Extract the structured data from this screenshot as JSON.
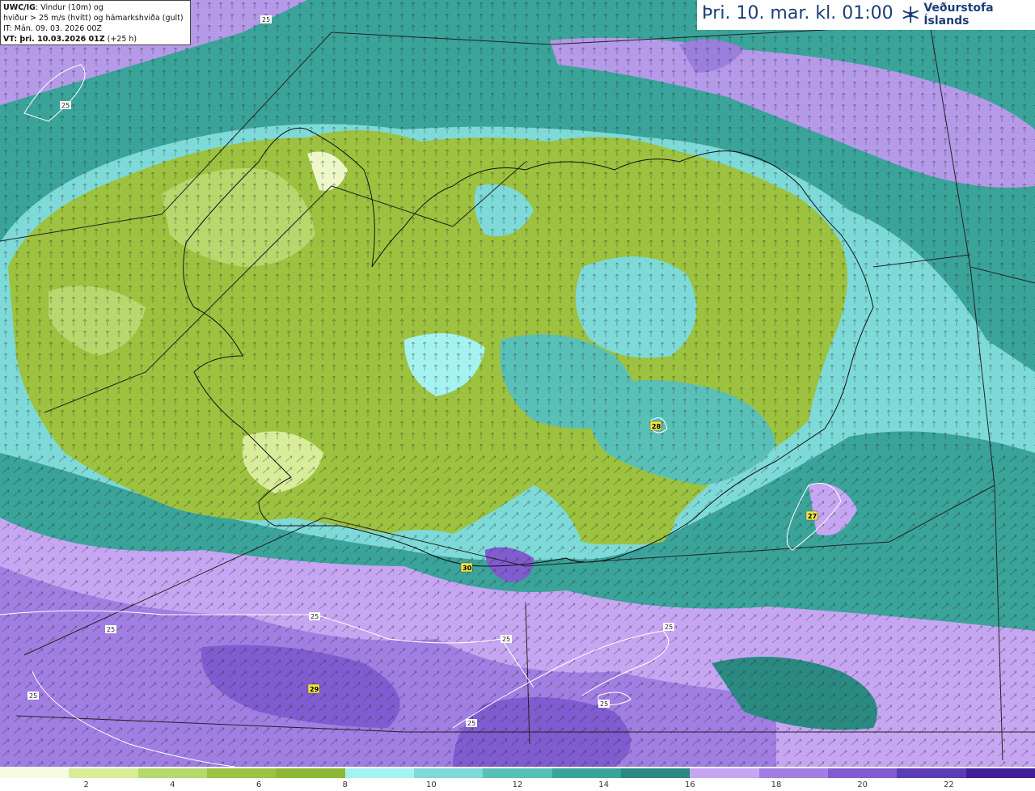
{
  "info": {
    "model": "UWC/IG",
    "line1_rest": ": Vindur (10m) og",
    "line2": "hviður > 25 m/s (hvítt) og hámarkshviða (gult)",
    "line3": "IT: Mán. 09. 03. 2026 00Z",
    "vt_label": "VT: þri. 10.03.2026 01Z",
    "vt_offset": "(+25 h)"
  },
  "header": {
    "time": "Þri. 10. mar. kl. 01:00",
    "logo_text": "Veðurstofa Íslands"
  },
  "legend": {
    "colors": [
      "#f7fbe0",
      "#d8ec9a",
      "#b6d86d",
      "#9cc23f",
      "#8db833",
      "#a4f3f0",
      "#7ddad8",
      "#59c0b8",
      "#3aa39a",
      "#2a8a82",
      "#c6a6f2",
      "#a07ee2",
      "#7f5ccf",
      "#5d3bb6",
      "#3f1f98"
    ],
    "ticks": [
      "2",
      "4",
      "6",
      "8",
      "10",
      "12",
      "14",
      "16",
      "18",
      "20",
      "22"
    ]
  },
  "max_gusts": [
    {
      "value": "28"
    },
    {
      "value": "27"
    },
    {
      "value": "30"
    },
    {
      "value": "29"
    }
  ],
  "contour_labels": [
    "25",
    "25",
    "25",
    "25",
    "25",
    "25",
    "25",
    "25",
    "25"
  ]
}
